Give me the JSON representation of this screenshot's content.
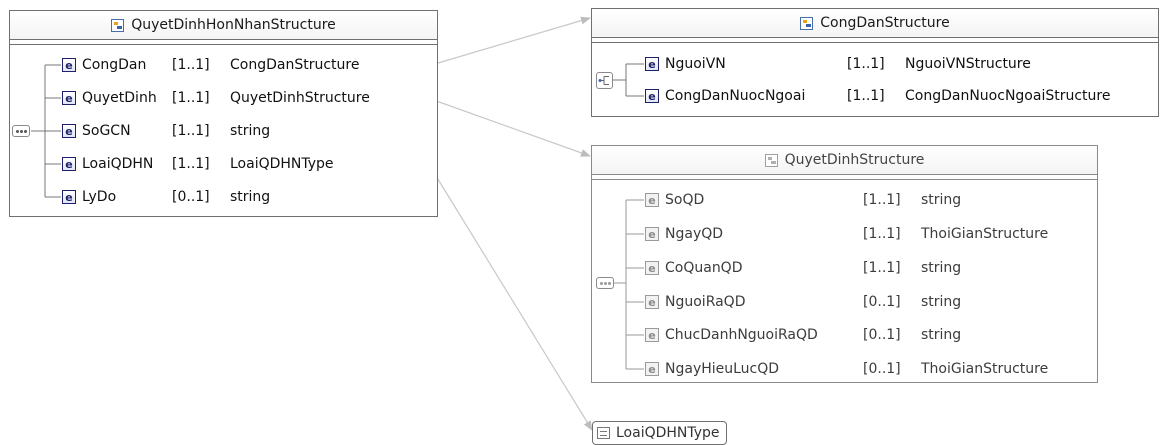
{
  "root": {
    "title": "QuyetDinhHonNhanStructure",
    "rows": [
      {
        "name": "CongDan",
        "card": "[1..1]",
        "type": "CongDanStructure"
      },
      {
        "name": "QuyetDinh",
        "card": "[1..1]",
        "type": "QuyetDinhStructure"
      },
      {
        "name": "SoGCN",
        "card": "[1..1]",
        "type": "string"
      },
      {
        "name": "LoaiQDHN",
        "card": "[1..1]",
        "type": "LoaiQDHNType"
      },
      {
        "name": "LyDo",
        "card": "[0..1]",
        "type": "string"
      }
    ]
  },
  "congdan": {
    "title": "CongDanStructure",
    "rows": [
      {
        "name": "NguoiVN",
        "card": "[1..1]",
        "type": "NguoiVNStructure"
      },
      {
        "name": "CongDanNuocNgoai",
        "card": "[1..1]",
        "type": "CongDanNuocNgoaiStructure"
      }
    ]
  },
  "quyetdinh": {
    "title": "QuyetDinhStructure",
    "rows": [
      {
        "name": "SoQD",
        "card": "[1..1]",
        "type": "string"
      },
      {
        "name": "NgayQD",
        "card": "[1..1]",
        "type": "ThoiGianStructure"
      },
      {
        "name": "CoQuanQD",
        "card": "[1..1]",
        "type": "string"
      },
      {
        "name": "NguoiRaQD",
        "card": "[0..1]",
        "type": "string"
      },
      {
        "name": "ChucDanhNguoiRaQD",
        "card": "[0..1]",
        "type": "string"
      },
      {
        "name": "NgayHieuLucQD",
        "card": "[0..1]",
        "type": "ThoiGianStructure"
      }
    ]
  },
  "simple_type": {
    "title": "LoaiQDHNType"
  },
  "icons": {
    "element": "element-icon",
    "element_letter": "e",
    "structure": "complex-type-icon",
    "sequence": "sequence-icon",
    "choice": "choice-icon",
    "simple": "simple-type-icon"
  },
  "colors": {
    "border": "#707070",
    "connector": "#c0c0c0",
    "element_icon": "#1f1f6a"
  }
}
